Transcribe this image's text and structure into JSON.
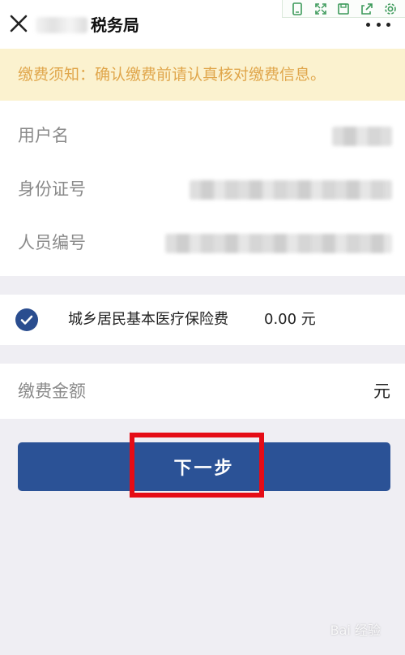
{
  "navbar": {
    "title": "税务局",
    "close_icon": "close-icon",
    "more_icon": "more-icon"
  },
  "notice": {
    "text": "缴费须知：确认缴费前请认真核对缴费信息。"
  },
  "info": {
    "username_label": "用户名",
    "id_number_label": "身份证号",
    "person_number_label": "人员编号"
  },
  "item": {
    "name": "城乡居民基本医疗保险费",
    "amount": "0.00 元",
    "checked": true
  },
  "total": {
    "label": "缴费金额",
    "unit": "元"
  },
  "next_button": {
    "label": "下一步"
  },
  "watermark": {
    "text": "Bai 经验"
  },
  "colors": {
    "primary": "#2b5296",
    "notice_bg": "#fbf2cf",
    "notice_text": "#e0a64b",
    "highlight": "#e50c16"
  }
}
